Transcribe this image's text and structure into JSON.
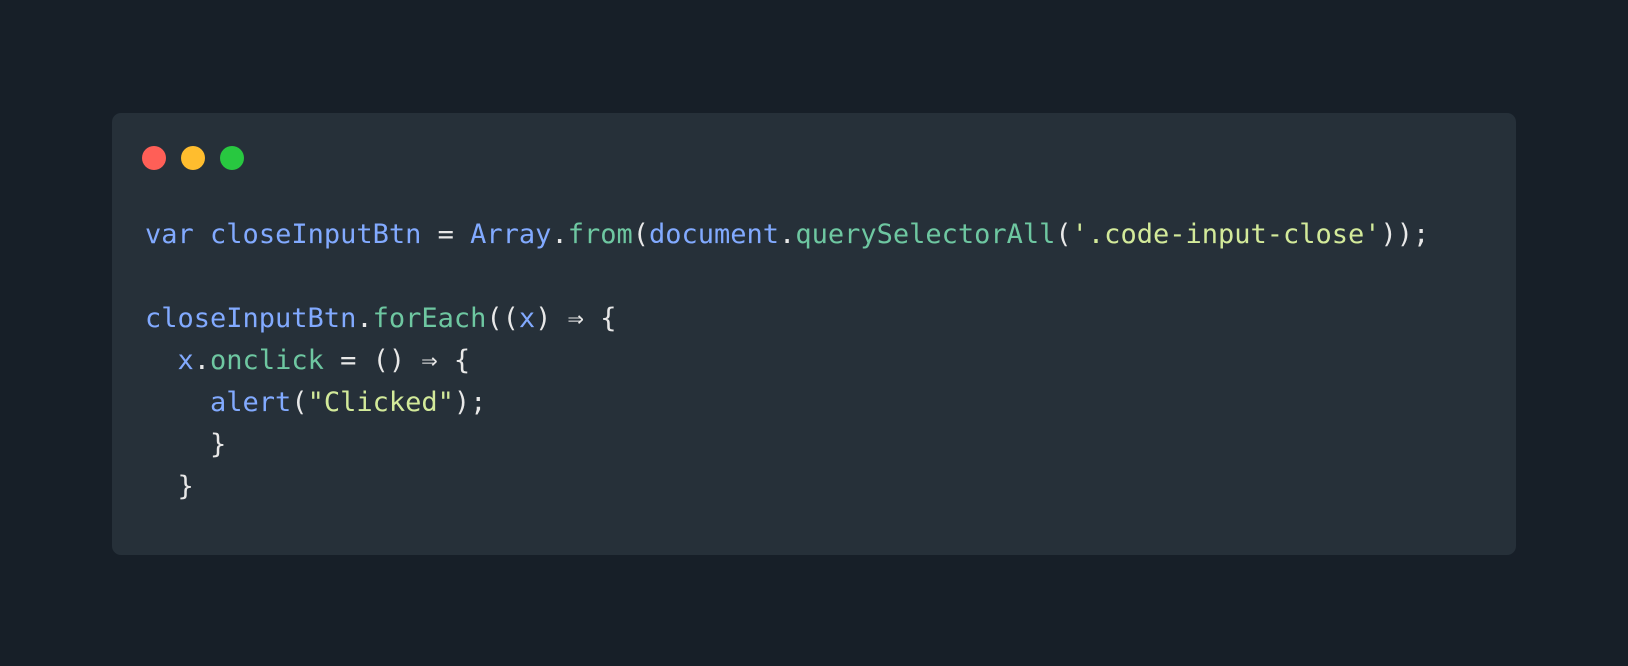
{
  "window": {
    "controls": [
      {
        "name": "close",
        "color": "#ff5f57"
      },
      {
        "name": "minimize",
        "color": "#ffbd2e"
      },
      {
        "name": "maximize",
        "color": "#28c840"
      }
    ]
  },
  "colors": {
    "background": "#171f28",
    "card": "#263039",
    "keyword": "#82aaff",
    "function": "#6ec7a1",
    "string": "#d3ea9a",
    "plain": "#e8e8e8"
  },
  "code": {
    "lines": [
      [
        {
          "t": "kw",
          "v": "var"
        },
        {
          "t": "punc",
          "v": " "
        },
        {
          "t": "var",
          "v": "closeInputBtn"
        },
        {
          "t": "punc",
          "v": " = "
        },
        {
          "t": "var",
          "v": "Array"
        },
        {
          "t": "punc",
          "v": "."
        },
        {
          "t": "fn",
          "v": "from"
        },
        {
          "t": "punc",
          "v": "("
        },
        {
          "t": "var",
          "v": "document"
        },
        {
          "t": "punc",
          "v": "."
        },
        {
          "t": "fn",
          "v": "querySelectorAll"
        },
        {
          "t": "punc",
          "v": "("
        },
        {
          "t": "str",
          "v": "'.code-input-close'"
        },
        {
          "t": "punc",
          "v": "));"
        }
      ],
      [],
      [
        {
          "t": "var",
          "v": "closeInputBtn"
        },
        {
          "t": "punc",
          "v": "."
        },
        {
          "t": "fn",
          "v": "forEach"
        },
        {
          "t": "punc",
          "v": "(("
        },
        {
          "t": "var",
          "v": "x"
        },
        {
          "t": "punc",
          "v": ") ⇒ {"
        }
      ],
      [
        {
          "t": "punc",
          "v": "  "
        },
        {
          "t": "var",
          "v": "x"
        },
        {
          "t": "punc",
          "v": "."
        },
        {
          "t": "fn",
          "v": "onclick"
        },
        {
          "t": "punc",
          "v": " = () ⇒ {"
        }
      ],
      [
        {
          "t": "punc",
          "v": "    "
        },
        {
          "t": "var",
          "v": "alert"
        },
        {
          "t": "punc",
          "v": "("
        },
        {
          "t": "str",
          "v": "\"Clicked\""
        },
        {
          "t": "punc",
          "v": ");"
        }
      ],
      [
        {
          "t": "punc",
          "v": "    }"
        }
      ],
      [
        {
          "t": "punc",
          "v": "  }"
        }
      ]
    ]
  }
}
